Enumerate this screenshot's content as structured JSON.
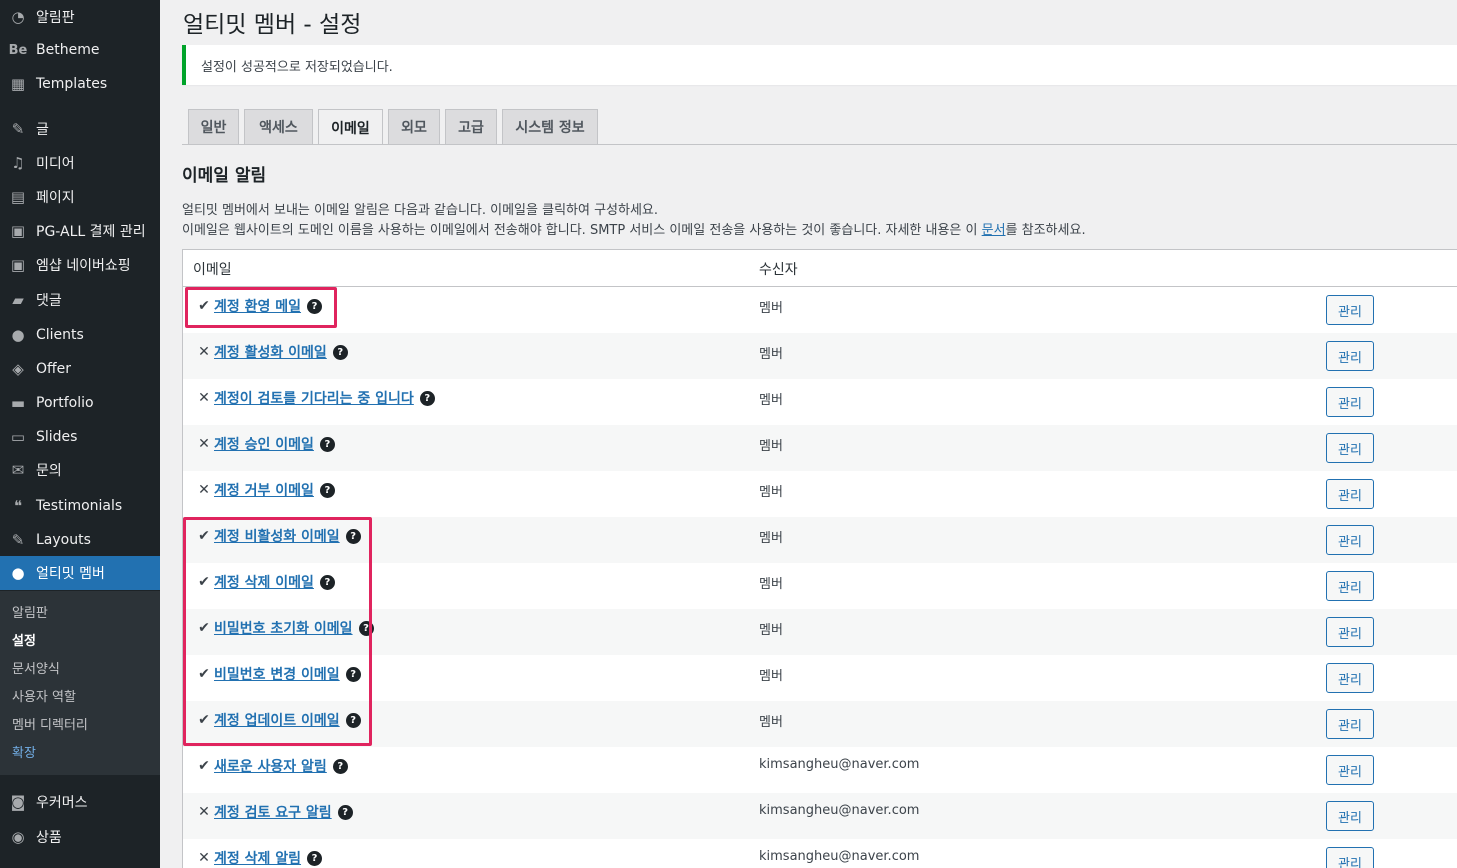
{
  "sidebar": {
    "items": [
      {
        "label": "알림판",
        "icon": "dashboard-icon",
        "glyph": "◔"
      },
      {
        "label": "Betheme",
        "icon": "betheme-icon",
        "glyph": "Be"
      },
      {
        "label": "Templates",
        "icon": "templates-icon",
        "glyph": "▦"
      },
      {
        "label": "글",
        "icon": "pin-icon",
        "glyph": "✎"
      },
      {
        "label": "미디어",
        "icon": "media-icon",
        "glyph": "♫"
      },
      {
        "label": "페이지",
        "icon": "page-icon",
        "glyph": "▤"
      },
      {
        "label": "PG-ALL 결제 관리",
        "icon": "lock-icon",
        "glyph": "▣"
      },
      {
        "label": "엠샵 네이버쇼핑",
        "icon": "lock-icon",
        "glyph": "▣"
      },
      {
        "label": "댓글",
        "icon": "comment-icon",
        "glyph": "▰"
      },
      {
        "label": "Clients",
        "icon": "user-icon",
        "glyph": "●"
      },
      {
        "label": "Offer",
        "icon": "tag-icon",
        "glyph": "◈"
      },
      {
        "label": "Portfolio",
        "icon": "folder-icon",
        "glyph": "▬"
      },
      {
        "label": "Slides",
        "icon": "slides-icon",
        "glyph": "▭"
      },
      {
        "label": "문의",
        "icon": "mail-icon",
        "glyph": "✉"
      },
      {
        "label": "Testimonials",
        "icon": "quote-icon",
        "glyph": "❝"
      },
      {
        "label": "Layouts",
        "icon": "edit-icon",
        "glyph": "✎"
      },
      {
        "label": "얼티밋 멤버",
        "icon": "member-icon",
        "glyph": "●"
      },
      {
        "label": "우커머스",
        "icon": "woo-icon",
        "glyph": "◙"
      },
      {
        "label": "상품",
        "icon": "product-icon",
        "glyph": "◉"
      }
    ],
    "submenu": [
      "알림판",
      "설정",
      "문서양식",
      "사용자 역할",
      "멤버 디렉터리",
      "확장"
    ]
  },
  "page": {
    "title": "얼티밋 멤버 - 설정",
    "notice": "설정이 성공적으로 저장되었습니다.",
    "tabs": [
      "일반",
      "액세스",
      "이메일",
      "외모",
      "고급",
      "시스템 정보"
    ],
    "active_tab": "이메일",
    "section_title": "이메일 알림",
    "desc1": "얼티밋 멤버에서 보내는 이메일 알림은 다음과 같습니다. 이메일을 클릭하여 구성하세요.",
    "desc2_before": "이메일은 웹사이트의 도메인 이름을 사용하는 이메일에서 전송해야 합니다. SMTP 서비스 이메일 전송을 사용하는 것이 좋습니다. 자세한 내용은 이 ",
    "desc2_link": "문서",
    "desc2_after": "를 참조하세요."
  },
  "table": {
    "col_email": "이메일",
    "col_recipient": "수신자",
    "manage_label": "관리",
    "help_glyph": "?",
    "rows": [
      {
        "enabled": true,
        "name": "계정 환영 메일",
        "recipient": "멤버"
      },
      {
        "enabled": false,
        "name": "계정 활성화 이메일",
        "recipient": "멤버"
      },
      {
        "enabled": false,
        "name": "계정이 검토를 기다리는 중 입니다",
        "recipient": "멤버"
      },
      {
        "enabled": false,
        "name": "계정 승인 이메일",
        "recipient": "멤버"
      },
      {
        "enabled": false,
        "name": "계정 거부 이메일",
        "recipient": "멤버"
      },
      {
        "enabled": true,
        "name": "계정 비활성화 이메일",
        "recipient": "멤버"
      },
      {
        "enabled": true,
        "name": "계정 삭제 이메일",
        "recipient": "멤버"
      },
      {
        "enabled": true,
        "name": "비밀번호 초기화 이메일",
        "recipient": "멤버"
      },
      {
        "enabled": true,
        "name": "비밀번호 변경 이메일",
        "recipient": "멤버"
      },
      {
        "enabled": true,
        "name": "계정 업데이트 이메일",
        "recipient": "멤버"
      },
      {
        "enabled": true,
        "name": "새로운 사용자 알림",
        "recipient": "kimsangheu@naver.com"
      },
      {
        "enabled": false,
        "name": "계정 검토 요구 알림",
        "recipient": "kimsangheu@naver.com"
      },
      {
        "enabled": false,
        "name": "계정 삭제 알림",
        "recipient": "kimsangheu@naver.com"
      }
    ]
  },
  "colors": {
    "sidebar_bg": "#1d2327",
    "active_menu": "#2271b1",
    "notice_border": "#00a32a",
    "highlight": "#e0245e"
  }
}
